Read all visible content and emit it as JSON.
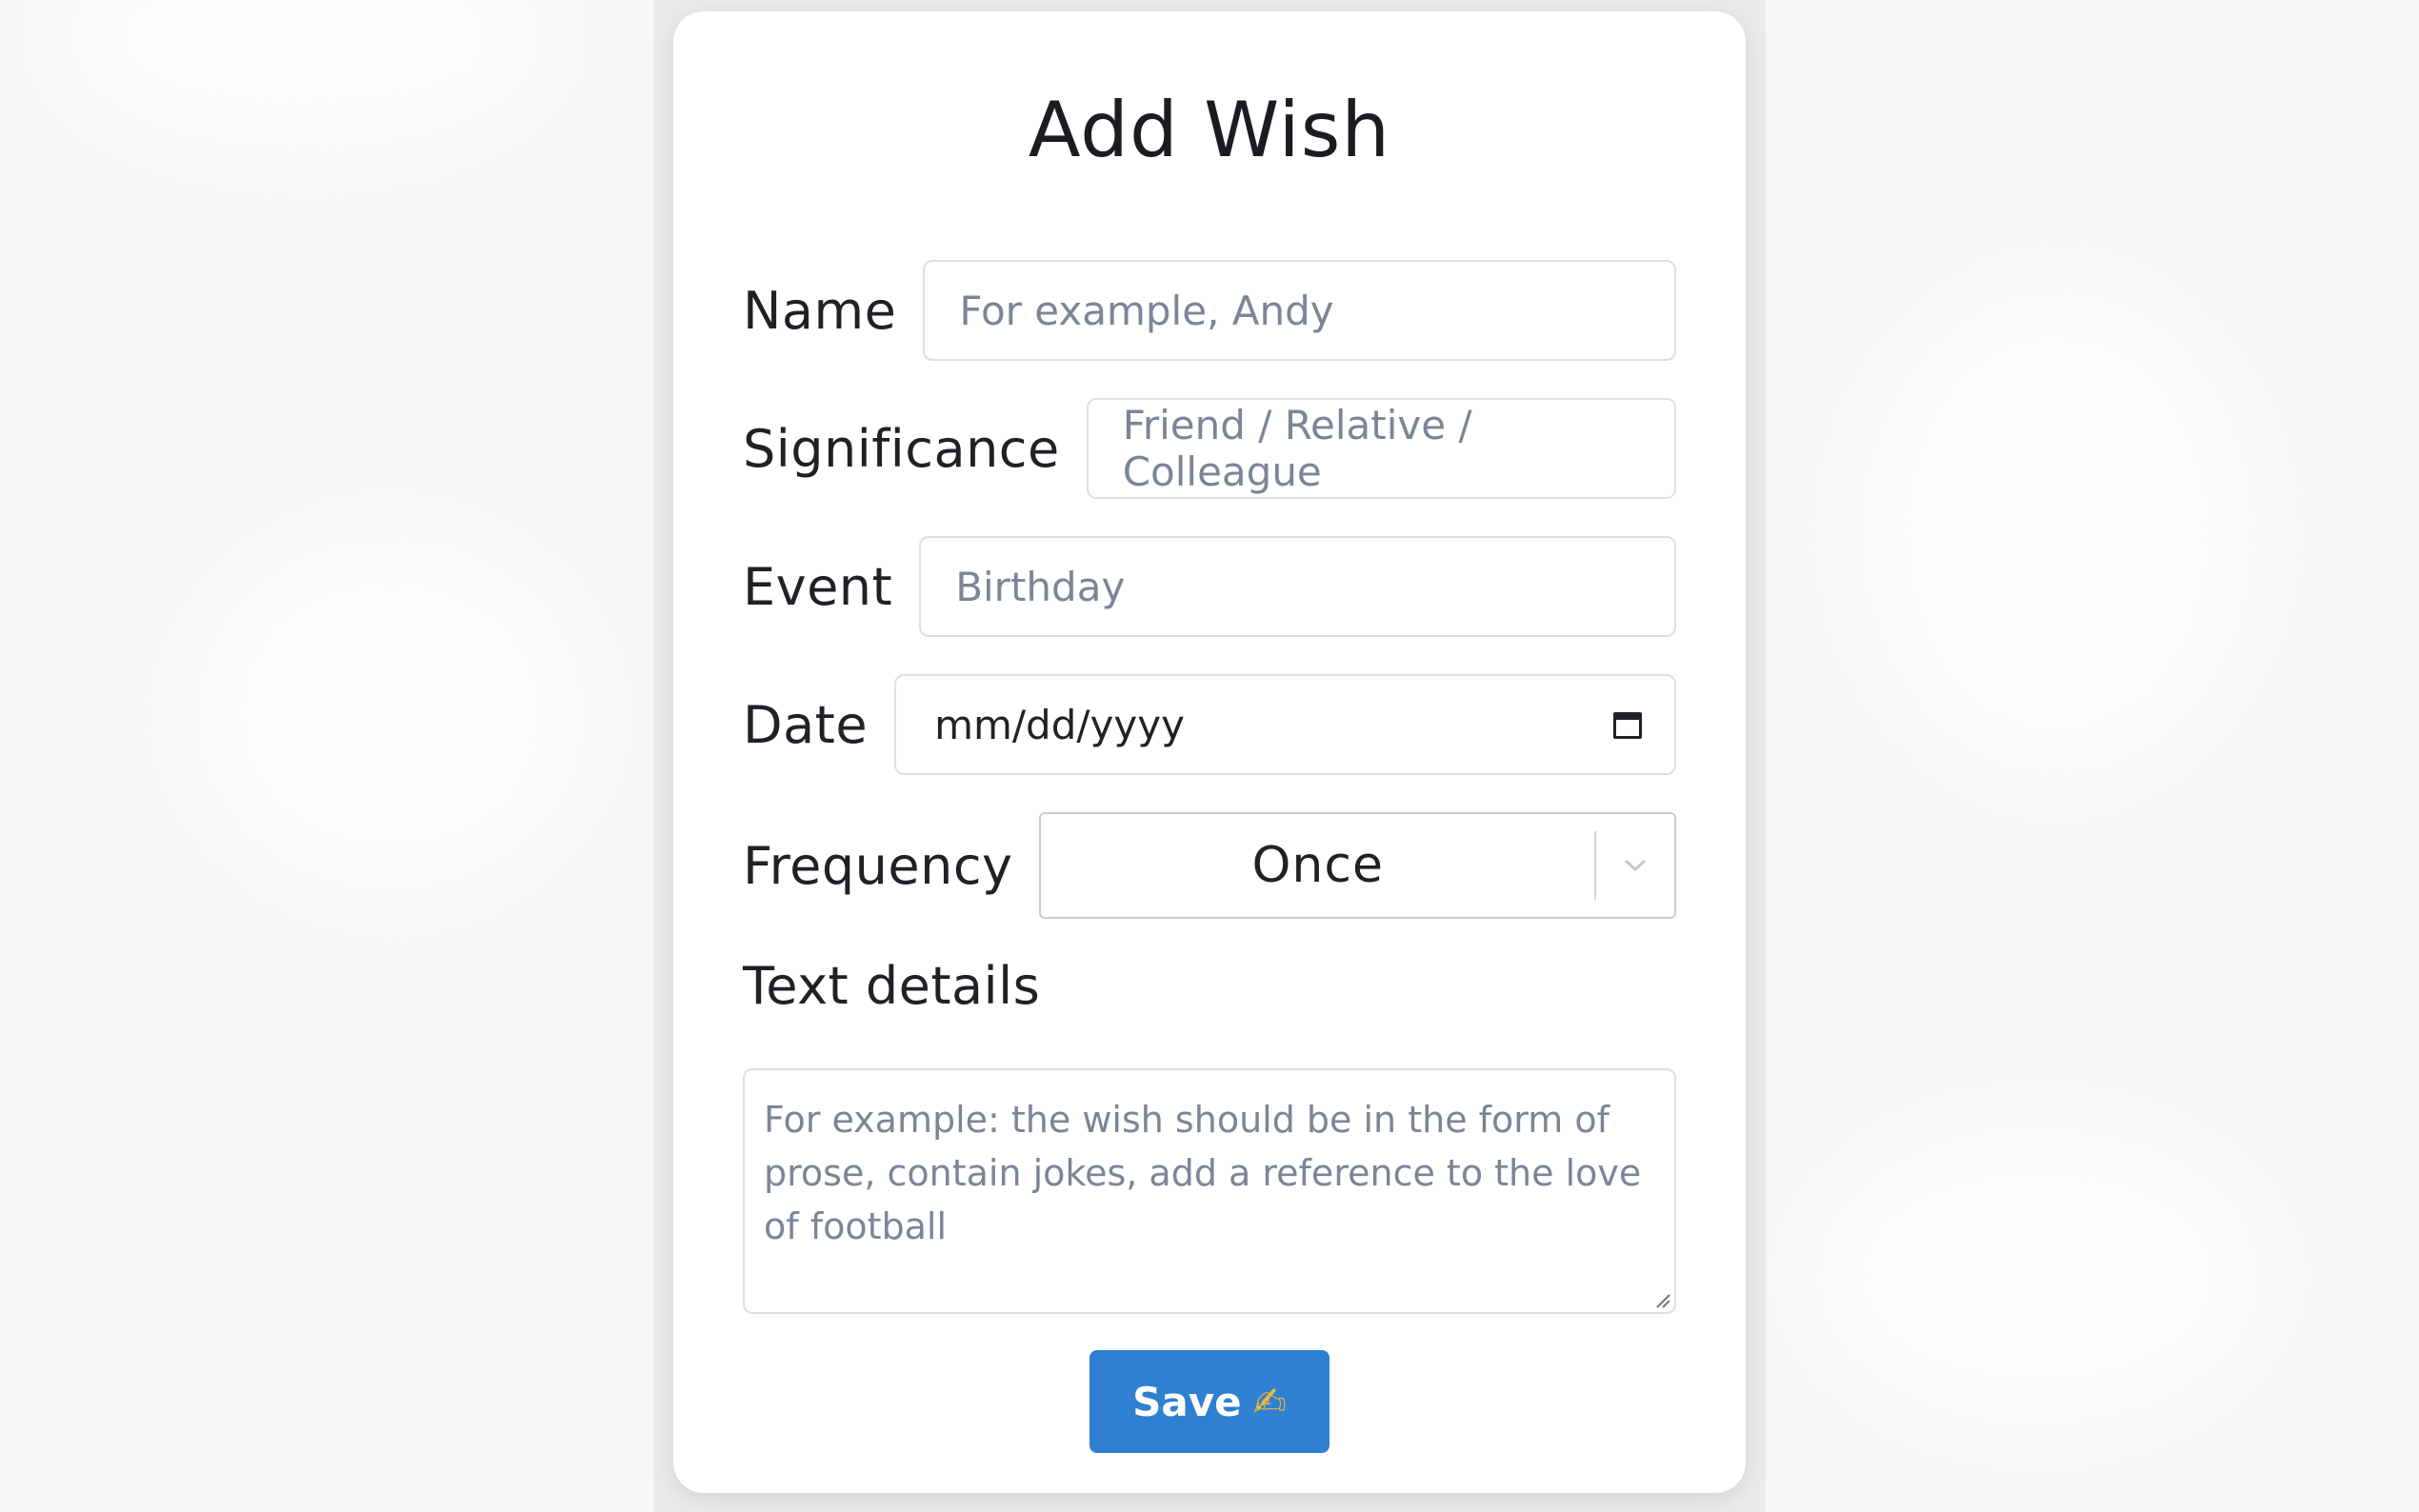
{
  "form": {
    "title": "Add Wish",
    "name": {
      "label": "Name",
      "placeholder": "For example, Andy"
    },
    "significance": {
      "label": "Significance",
      "placeholder": "Friend / Relative / Colleague"
    },
    "event": {
      "label": "Event",
      "placeholder": "Birthday"
    },
    "date": {
      "label": "Date",
      "placeholder": "mm/dd/yyyy",
      "icon": "calendar-icon"
    },
    "frequency": {
      "label": "Frequency",
      "selected": "Once",
      "icon": "chevron-down-icon"
    },
    "text_details": {
      "label": "Text details",
      "placeholder": "For example: the wish should be in the form of prose, contain jokes, add a reference to the love of football"
    },
    "save": {
      "label": "Save",
      "emoji": "✍"
    }
  },
  "colors": {
    "primary_button": "#2f80d0",
    "placeholder": "#7c8597",
    "text": "#1f2126",
    "background": "#f7f7f7"
  }
}
